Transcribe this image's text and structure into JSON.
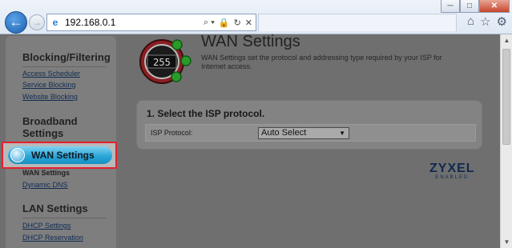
{
  "browser": {
    "address": "192.168.0.1",
    "window_buttons": [
      "─",
      "□",
      "✕"
    ],
    "address_tools": [
      "⌕ ▾",
      "🔒",
      "↻",
      "✕"
    ],
    "toolbar_icons": [
      "home-icon",
      "star-icon",
      "gear-icon"
    ]
  },
  "sidebar": {
    "sections": [
      {
        "title": "Blocking/Filtering",
        "links": [
          "Access Scheduler",
          "Service Blocking",
          "Website Blocking"
        ]
      },
      {
        "title": "Broadband Settings",
        "title_lines": [
          "Broadband",
          "Settings"
        ]
      },
      {
        "title": "WAN Settings",
        "selected": true,
        "current_sub": "WAN Settings",
        "links": [
          "Dynamic DNS"
        ]
      },
      {
        "title": "LAN Settings",
        "links": [
          "DHCP Settings",
          "DHCP Reservation"
        ]
      }
    ]
  },
  "main": {
    "logo_text": "255",
    "title": "WAN Settings",
    "description": "WAN Settings set the protocol and addressing type required by your ISP for Internet access.",
    "isp_section": {
      "title": "1. Select the ISP protocol.",
      "label": "ISP Protocol:",
      "selected_value": "Auto Select"
    },
    "brand": {
      "name": "ZYXEL",
      "tagline": "ENABLED"
    }
  },
  "colors": {
    "highlight_border": "#e3212f",
    "selected_pill": "#2ba6d7",
    "page_background": "#6f6f6f"
  }
}
